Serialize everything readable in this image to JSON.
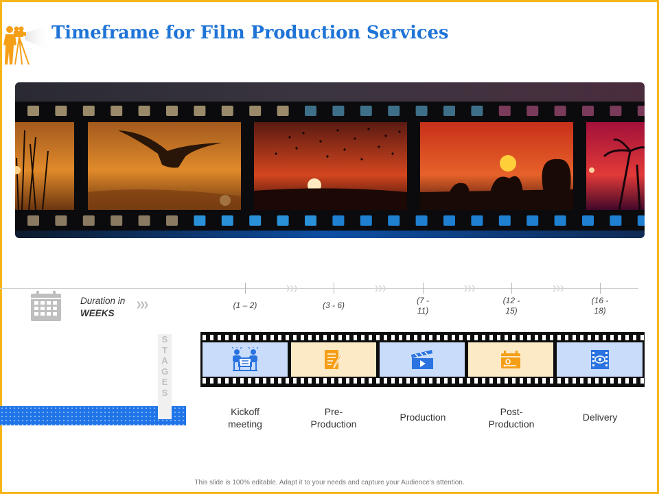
{
  "title": "Timeframe for Film Production Services",
  "duration": {
    "line1": "Duration in",
    "line2": "WEEKS"
  },
  "weeks": [
    {
      "line1": "(1 – 2)",
      "line2": ""
    },
    {
      "line1": "(3 - 6)",
      "line2": ""
    },
    {
      "line1": "(7 -",
      "line2": "11)"
    },
    {
      "line1": "(12 -",
      "line2": "15)"
    },
    {
      "line1": "(16 -",
      "line2": "18)"
    }
  ],
  "stages_letters": [
    "S",
    "T",
    "A",
    "G",
    "E",
    "S"
  ],
  "stages": [
    {
      "line1": "Kickoff",
      "line2": "meeting",
      "icon": "meeting-icon",
      "bg": "#c9dcfa"
    },
    {
      "line1": "Pre-",
      "line2": "Production",
      "icon": "script-icon",
      "bg": "#fce9c6"
    },
    {
      "line1": "Production",
      "line2": "",
      "icon": "clapperboard-icon",
      "bg": "#c9dcfa"
    },
    {
      "line1": "Post-",
      "line2": "Production",
      "icon": "editing-icon",
      "bg": "#fce9c6"
    },
    {
      "line1": "Delivery",
      "line2": "",
      "icon": "film-reel-icon",
      "bg": "#c9dcfa"
    }
  ],
  "colors": {
    "accent_blue": "#1f74d6",
    "accent_orange": "#f7b519",
    "icon_blue": "#2a73e0",
    "icon_orange": "#f59f17"
  },
  "footer": "This slide is 100% editable. Adapt it to your needs and capture your Audience's attention."
}
